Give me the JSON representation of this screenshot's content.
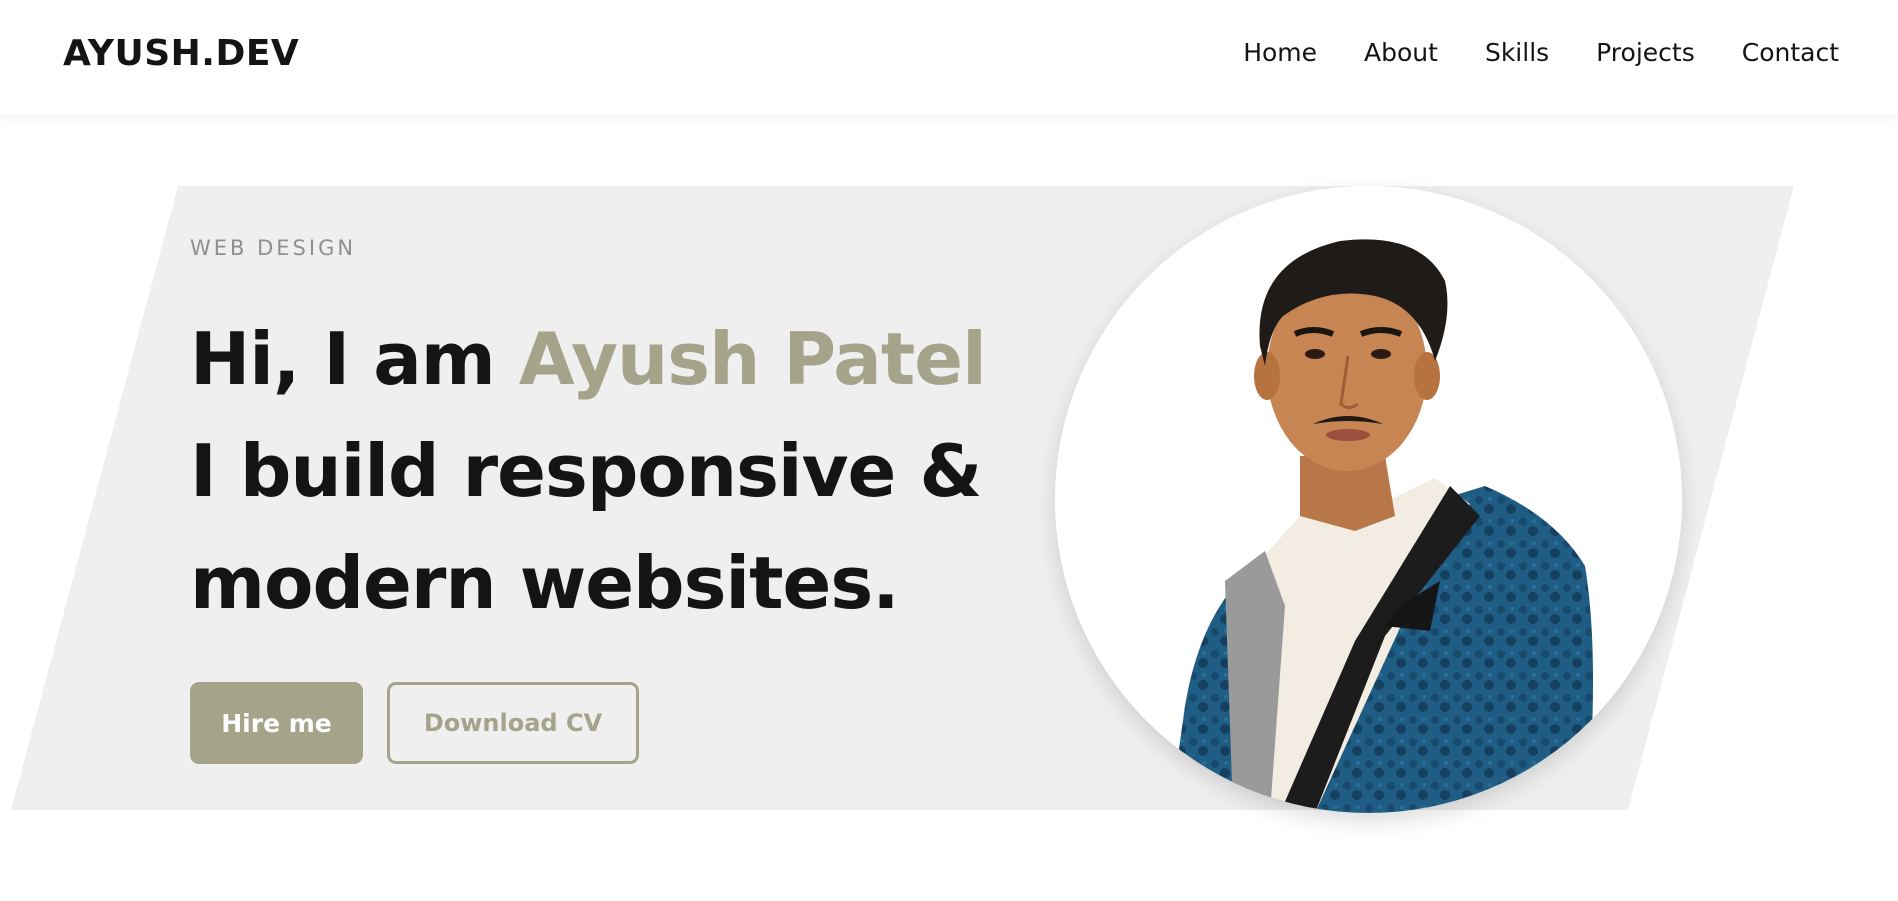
{
  "header": {
    "logo": "AYUSH.DEV",
    "nav": [
      "Home",
      "About",
      "Skills",
      "Projects",
      "Contact"
    ]
  },
  "hero": {
    "eyebrow": "WEB DESIGN",
    "greeting": "Hi, I am",
    "name": "Ayush Patel",
    "line2": "I build responsive &",
    "line3": "modern websites.",
    "primary_button": "Hire me",
    "secondary_button": "Download CV"
  },
  "colors": {
    "accent": "#a5a38a",
    "text": "#141414",
    "hero_bg": "#efefef",
    "muted": "#8f8f8f"
  },
  "icons": {
    "portrait": "profile-photo"
  }
}
